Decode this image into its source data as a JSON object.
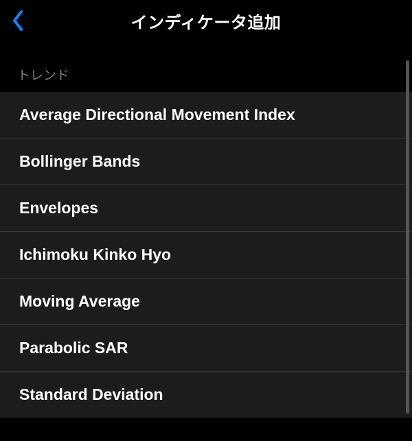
{
  "header": {
    "title": "インディケータ追加"
  },
  "section": {
    "header": "トレンド"
  },
  "indicators": [
    {
      "label": "Average Directional Movement Index"
    },
    {
      "label": "Bollinger Bands"
    },
    {
      "label": "Envelopes"
    },
    {
      "label": "Ichimoku Kinko Hyo"
    },
    {
      "label": "Moving Average"
    },
    {
      "label": "Parabolic SAR"
    },
    {
      "label": "Standard Deviation"
    }
  ]
}
